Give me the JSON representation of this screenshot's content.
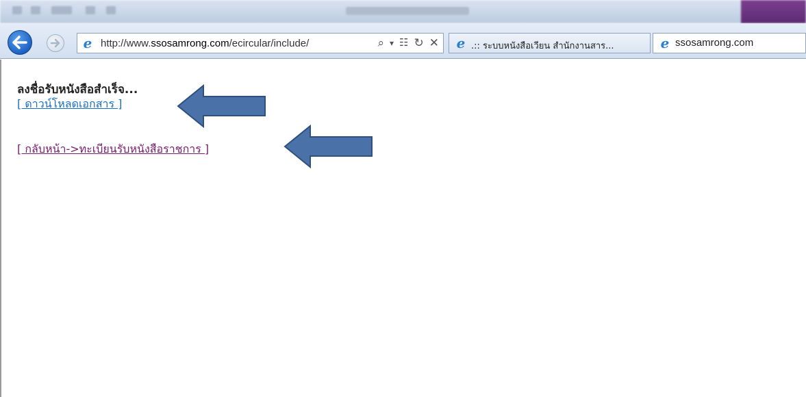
{
  "browser": {
    "address": {
      "url_prefix": "http://www.",
      "url_domain": "ssosamrong.com",
      "url_path": "/ecircular/include/"
    },
    "address_icons": [
      "search-icon",
      "dropdown-icon",
      "compat-icon",
      "refresh-icon",
      "stop-icon"
    ],
    "tabs": [
      {
        "label": ".:: ระบบหนังสือเวียน สำนักงานสาร...",
        "active": false
      },
      {
        "label": "ssosamrong.com",
        "active": true
      }
    ]
  },
  "page": {
    "status_message": "ลงชื่อรับหนังสือสำเร็จ...",
    "download_link": "[ ดาวน์โหลดเอกสาร ]",
    "back_link": "[ กลับหน้า->ทะเบียนรับหนังสือราชการ ]"
  },
  "colors": {
    "link": "#1a6fc4",
    "visited_link": "#7a1a6e",
    "annotation_arrow": "#4a72a8"
  }
}
